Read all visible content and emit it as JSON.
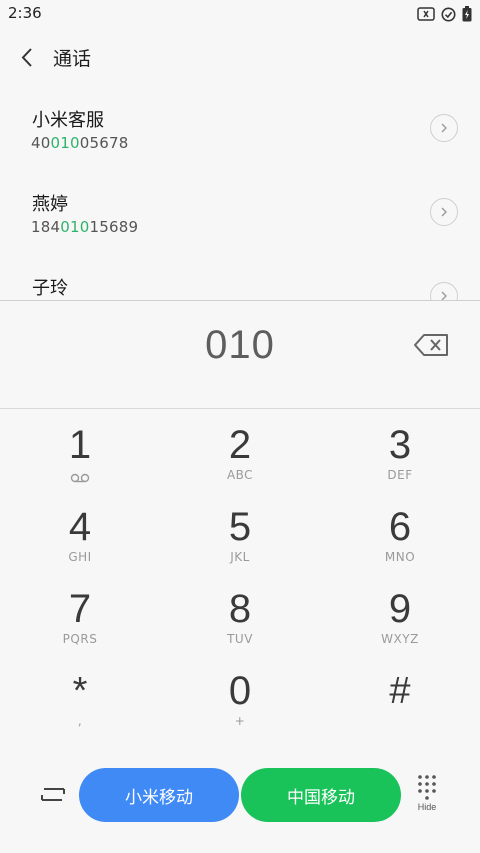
{
  "status_bar": {
    "time": "2:36",
    "icons": [
      "sim-card-icon",
      "check-circle-icon",
      "battery-charging-icon"
    ]
  },
  "header": {
    "back_icon": "chevron-left-icon",
    "title": "通话"
  },
  "results": [
    {
      "name": "小米客服",
      "number_prefix": "40",
      "number_match": "010",
      "number_suffix": "05678"
    },
    {
      "name": "燕婷",
      "number_prefix": "184",
      "number_match": "010",
      "number_suffix": "15689"
    },
    {
      "name": "子玲",
      "number_prefix": "",
      "number_match": "",
      "number_suffix": ""
    }
  ],
  "dial_input": {
    "value": "010",
    "backspace_icon": "backspace-icon"
  },
  "keypad": [
    {
      "digit": "1",
      "letters": "",
      "sub_icon": "voicemail-icon"
    },
    {
      "digit": "2",
      "letters": "ABC"
    },
    {
      "digit": "3",
      "letters": "DEF"
    },
    {
      "digit": "4",
      "letters": "GHI"
    },
    {
      "digit": "5",
      "letters": "JKL"
    },
    {
      "digit": "6",
      "letters": "MNO"
    },
    {
      "digit": "7",
      "letters": "PQRS"
    },
    {
      "digit": "8",
      "letters": "TUV"
    },
    {
      "digit": "9",
      "letters": "WXYZ"
    },
    {
      "digit": "*",
      "letters": ","
    },
    {
      "digit": "0",
      "letters": "+"
    },
    {
      "digit": "#",
      "letters": ""
    }
  ],
  "bottom_bar": {
    "swap_icon": "swap-sim-icon",
    "call_sim1_label": "小米移动",
    "call_sim2_label": "中国移动",
    "hide_label": "Hide",
    "hide_icon": "dialpad-icon"
  },
  "colors": {
    "highlight": "#2fb36a",
    "sim1": "#3f8af4",
    "sim2": "#19c35a",
    "background": "#f7f7f7"
  }
}
